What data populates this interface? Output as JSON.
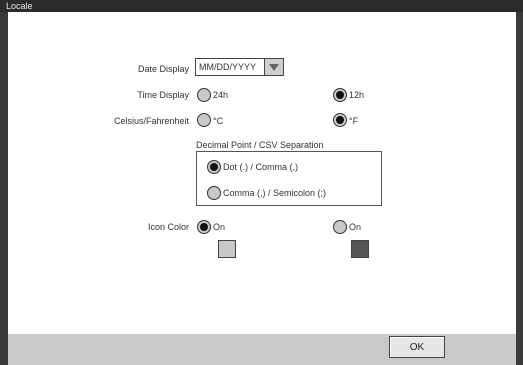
{
  "window": {
    "title": "Locale"
  },
  "date_display": {
    "label": "Date Display",
    "value": "MM/DD/YYYY"
  },
  "time_display": {
    "label": "Time Display",
    "options": [
      {
        "text": "24h",
        "checked": false
      },
      {
        "text": "12h",
        "checked": true
      }
    ]
  },
  "temperature": {
    "label": "Celsius/Fahrenheit",
    "options": [
      {
        "text": "°C",
        "checked": false
      },
      {
        "text": "°F",
        "checked": true
      }
    ]
  },
  "decimal_group": {
    "title": "Decimal Point / CSV Separation",
    "options": [
      {
        "text": "Dot (.) / Comma (,)",
        "checked": true
      },
      {
        "text": "Comma (,) / Semicolon (;)",
        "checked": false
      }
    ]
  },
  "icon_color": {
    "label": "Icon Color",
    "options": [
      {
        "text": "On",
        "checked": true,
        "swatch": "#c8c8c8"
      },
      {
        "text": "On",
        "checked": false,
        "swatch": "#555555"
      }
    ]
  },
  "footer": {
    "ok_label": "OK"
  }
}
